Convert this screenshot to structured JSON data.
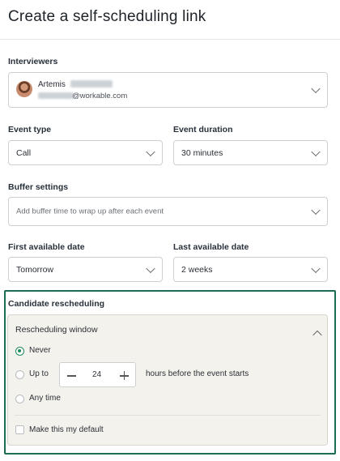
{
  "header": {
    "title": "Create a self-scheduling link"
  },
  "interviewers": {
    "label": "Interviewers",
    "name": "Artemis",
    "email_suffix": "@workable.com"
  },
  "event_type": {
    "label": "Event type",
    "value": "Call"
  },
  "event_duration": {
    "label": "Event duration",
    "value": "30 minutes"
  },
  "buffer": {
    "label": "Buffer settings",
    "placeholder": "Add buffer time to wrap up after each event"
  },
  "first_date": {
    "label": "First available date",
    "value": "Tomorrow"
  },
  "last_date": {
    "label": "Last available date",
    "value": "2 weeks"
  },
  "rescheduling": {
    "label": "Candidate rescheduling",
    "window_label": "Rescheduling window",
    "options": {
      "never": "Never",
      "up_to": "Up to",
      "any_time": "Any time"
    },
    "hours_value": "24",
    "hours_suffix": "hours before the event starts",
    "default_label": "Make this my default",
    "selected": "never"
  },
  "colors": {
    "accent": "#1f8a5b",
    "section_border": "#1c6b55",
    "panel_bg": "#f4f2ed"
  },
  "icons": [
    "chevron-down-icon",
    "chevron-up-icon",
    "minus-icon",
    "plus-icon",
    "avatar"
  ]
}
